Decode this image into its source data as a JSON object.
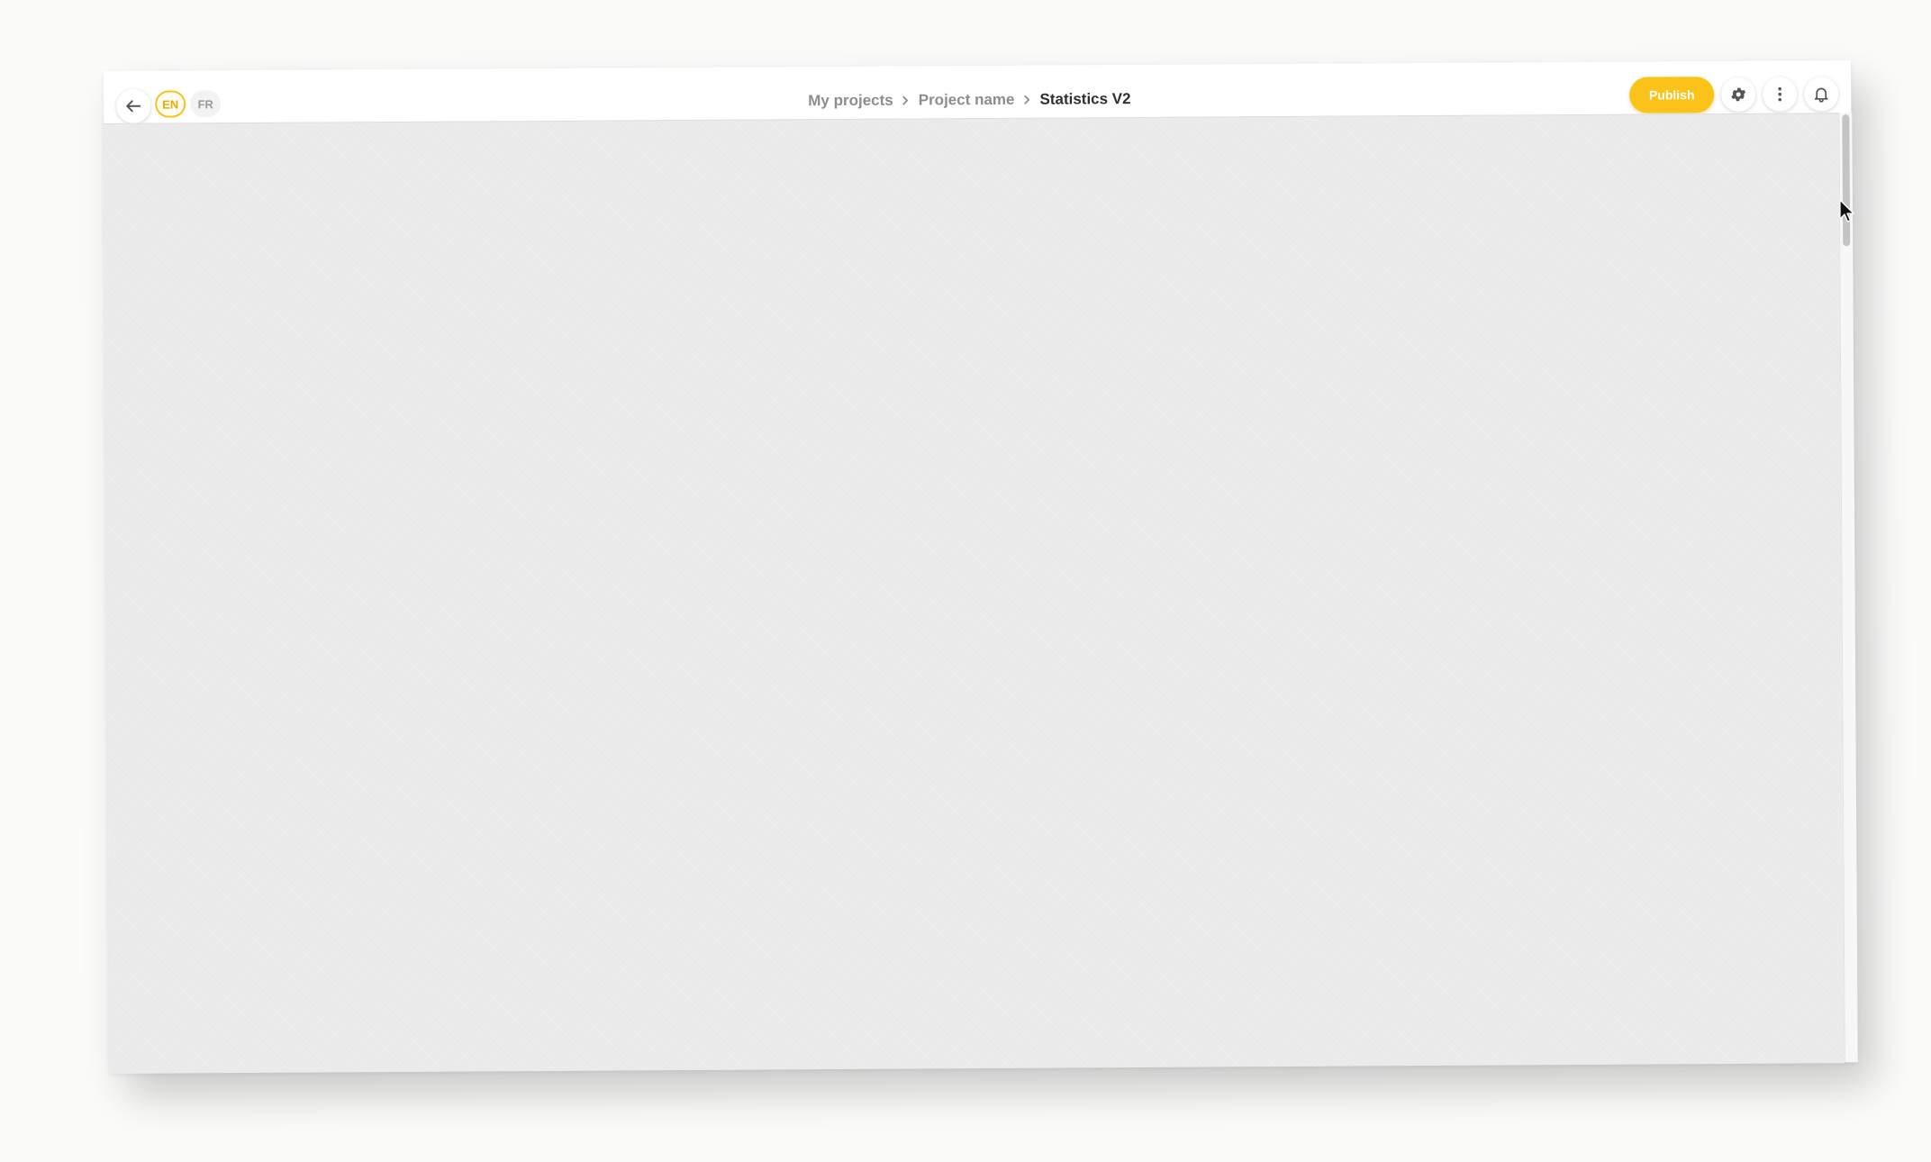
{
  "toolbar": {
    "languages": [
      {
        "code": "EN",
        "active": true
      },
      {
        "code": "FR",
        "active": false
      }
    ],
    "breadcrumb": {
      "items": [
        "My projects",
        "Project name"
      ],
      "current": "Statistics V2"
    },
    "publish_label": "Publish",
    "icons": {
      "back": "arrow-left-icon",
      "settings": "gear-icon",
      "more": "vertical-dots-icon",
      "notifications": "bell-icon",
      "separator": "chevron-right-icon"
    }
  },
  "colors": {
    "accent": "#fbc319",
    "canvas": "#ececec",
    "page_background": "#fbfbfa"
  }
}
